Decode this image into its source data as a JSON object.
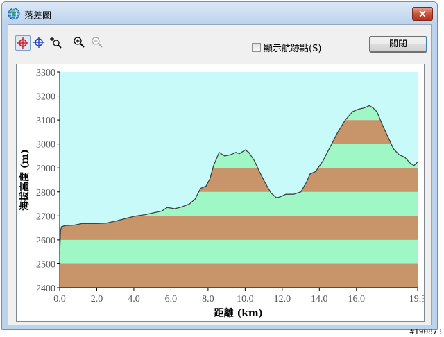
{
  "window": {
    "title": "落差圖",
    "close_glyph": "✕"
  },
  "toolbar": {
    "tools": [
      {
        "name": "crosshair-red-icon",
        "active": true
      },
      {
        "name": "crosshair-blue-icon",
        "active": false
      },
      {
        "name": "zoom-area-icon",
        "active": false
      },
      {
        "name": "zoom-in-icon",
        "active": false
      },
      {
        "name": "zoom-out-icon",
        "active": false,
        "disabled": true
      }
    ],
    "show_waypoints_label": "顯示航跡點(S)",
    "show_waypoints_checked": false,
    "close_button_label": "關閉"
  },
  "colors": {
    "sky": "#c8fafa",
    "band_green": "#9ef7c4",
    "band_brown": "#c8956a",
    "profile_line": "#404040"
  },
  "chart_data": {
    "type": "area",
    "xlabel": "距離 (km)",
    "ylabel": "海拔高度 (m)",
    "xlim": [
      0.0,
      19.3
    ],
    "ylim": [
      2400,
      3300
    ],
    "xticks": [
      "0.0",
      "2.0",
      "4.0",
      "6.0",
      "8.0",
      "10.0",
      "12.0",
      "14.0",
      "16.0",
      "19.3"
    ],
    "xtick_values": [
      0,
      2,
      4,
      6,
      8,
      10,
      12,
      14,
      16,
      19.3
    ],
    "yticks": [
      2400,
      2500,
      2600,
      2700,
      2800,
      2900,
      3000,
      3100,
      3200,
      3300
    ],
    "band_size": 100,
    "x": [
      0.0,
      0.05,
      0.1,
      0.3,
      0.8,
      1.2,
      2.0,
      2.5,
      3.0,
      3.5,
      4.0,
      4.6,
      5.0,
      5.5,
      5.8,
      6.2,
      6.6,
      7.0,
      7.3,
      7.6,
      7.9,
      8.1,
      8.3,
      8.6,
      8.9,
      9.2,
      9.5,
      9.7,
      10.0,
      10.2,
      10.5,
      10.8,
      11.1,
      11.4,
      11.7,
      11.9,
      12.2,
      12.6,
      13.0,
      13.3,
      13.5,
      13.8,
      14.2,
      14.6,
      15.0,
      15.4,
      15.8,
      16.1,
      16.4,
      16.7,
      16.9,
      17.1,
      17.4,
      17.7,
      18.0,
      18.3,
      18.6,
      18.9,
      19.1,
      19.3
    ],
    "y": [
      2540,
      2640,
      2655,
      2660,
      2662,
      2668,
      2668,
      2670,
      2678,
      2688,
      2698,
      2705,
      2712,
      2720,
      2735,
      2730,
      2738,
      2750,
      2770,
      2815,
      2825,
      2855,
      2910,
      2965,
      2950,
      2955,
      2965,
      2960,
      2975,
      2965,
      2930,
      2880,
      2835,
      2795,
      2775,
      2780,
      2790,
      2790,
      2800,
      2840,
      2875,
      2885,
      2930,
      2990,
      3050,
      3100,
      3135,
      3145,
      3150,
      3160,
      3150,
      3135,
      3080,
      3030,
      2980,
      2955,
      2945,
      2920,
      2910,
      2925
    ]
  },
  "footer": {
    "watermark": "#190873"
  }
}
